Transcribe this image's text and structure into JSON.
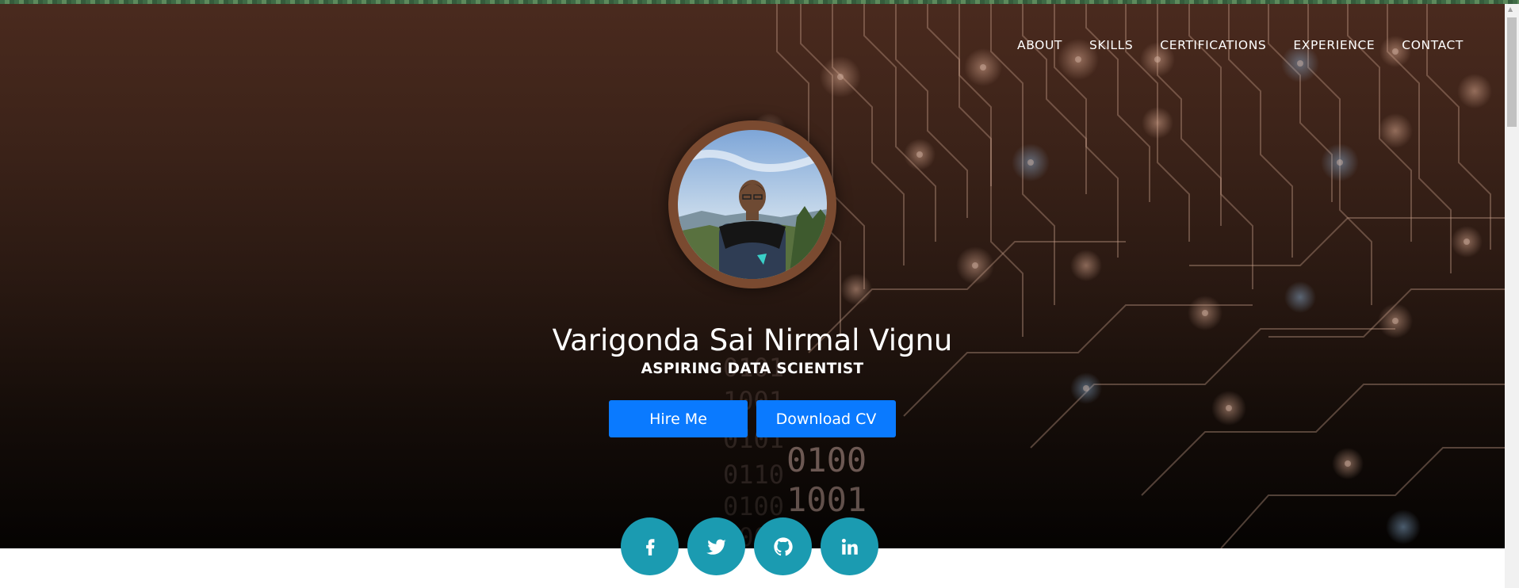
{
  "nav": {
    "items": [
      "ABOUT",
      "SKILLS",
      "CERTIFICATIONS",
      "EXPERIENCE",
      "CONTACT"
    ]
  },
  "hero": {
    "name": "Varigonda Sai Nirmal Vignu",
    "subtitle": "ASPIRING DATA SCIENTIST",
    "hire_label": "Hire Me",
    "download_label": "Download CV",
    "binary_lines": [
      "0101",
      "1001",
      "0110",
      "0100",
      "1001",
      "0101",
      "0110",
      "0100",
      "1001"
    ]
  },
  "social": {
    "icons": [
      "facebook-icon",
      "twitter-icon",
      "github-icon",
      "linkedin-icon"
    ]
  },
  "colors": {
    "button_blue": "#0a7aff",
    "social_teal": "#1b9bb1",
    "hero_top": "#4a2a1e",
    "hero_bottom": "#050302",
    "avatar_ring": "#7a4a30"
  }
}
